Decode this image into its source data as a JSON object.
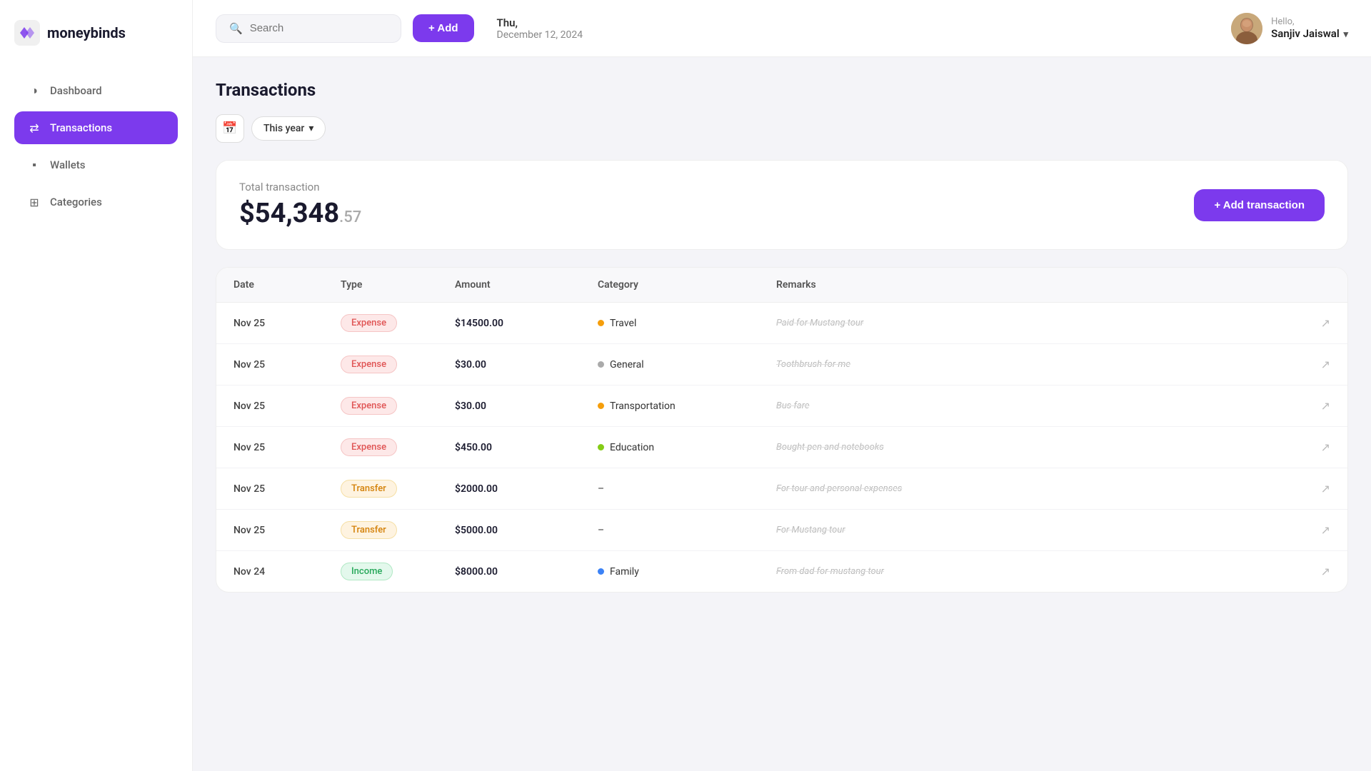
{
  "logo": {
    "text": "moneybinds"
  },
  "sidebar": {
    "items": [
      {
        "id": "dashboard",
        "label": "Dashboard",
        "icon": "◑",
        "active": false
      },
      {
        "id": "transactions",
        "label": "Transactions",
        "icon": "⇄",
        "active": true
      },
      {
        "id": "wallets",
        "label": "Wallets",
        "icon": "▪",
        "active": false
      },
      {
        "id": "categories",
        "label": "Categories",
        "icon": "⊞",
        "active": false
      }
    ]
  },
  "header": {
    "search_placeholder": "Search",
    "add_label": "+ Add",
    "date_day": "Thu,",
    "date_full": "December 12, 2024",
    "hello_text": "Hello,",
    "user_name": "Sanjiv Jaiswal"
  },
  "filters": {
    "year_label": "This year",
    "calendar_icon": "📅"
  },
  "page": {
    "title": "Transactions",
    "total_label": "Total transaction",
    "total_main": "$54,348",
    "total_cents": ".57",
    "add_transaction_label": "+ Add transaction"
  },
  "table": {
    "columns": [
      "Date",
      "Type",
      "Amount",
      "Category",
      "Remarks",
      ""
    ],
    "rows": [
      {
        "date": "Nov 25",
        "type": "Expense",
        "type_class": "expense",
        "amount": "$14500.00",
        "category_dot": "#f59e0b",
        "category": "Travel",
        "remarks": "Paid for Mustang tour"
      },
      {
        "date": "Nov 25",
        "type": "Expense",
        "type_class": "expense",
        "amount": "$30.00",
        "category_dot": "#aaaaaa",
        "category": "General",
        "remarks": "Toothbrush for me"
      },
      {
        "date": "Nov 25",
        "type": "Expense",
        "type_class": "expense",
        "amount": "$30.00",
        "category_dot": "#f59e0b",
        "category": "Transportation",
        "remarks": "Bus fare"
      },
      {
        "date": "Nov 25",
        "type": "Expense",
        "type_class": "expense",
        "amount": "$450.00",
        "category_dot": "#84cc16",
        "category": "Education",
        "remarks": "Bought pen and notebooks"
      },
      {
        "date": "Nov 25",
        "type": "Transfer",
        "type_class": "transfer",
        "amount": "$2000.00",
        "category_dot": "",
        "category": "–",
        "remarks": "For tour and personal expenses"
      },
      {
        "date": "Nov 25",
        "type": "Transfer",
        "type_class": "transfer",
        "amount": "$5000.00",
        "category_dot": "",
        "category": "–",
        "remarks": "For Mustang tour"
      },
      {
        "date": "Nov 24",
        "type": "Income",
        "type_class": "income",
        "amount": "$8000.00",
        "category_dot": "#3b82f6",
        "category": "Family",
        "remarks": "From dad for mustang tour"
      }
    ]
  }
}
